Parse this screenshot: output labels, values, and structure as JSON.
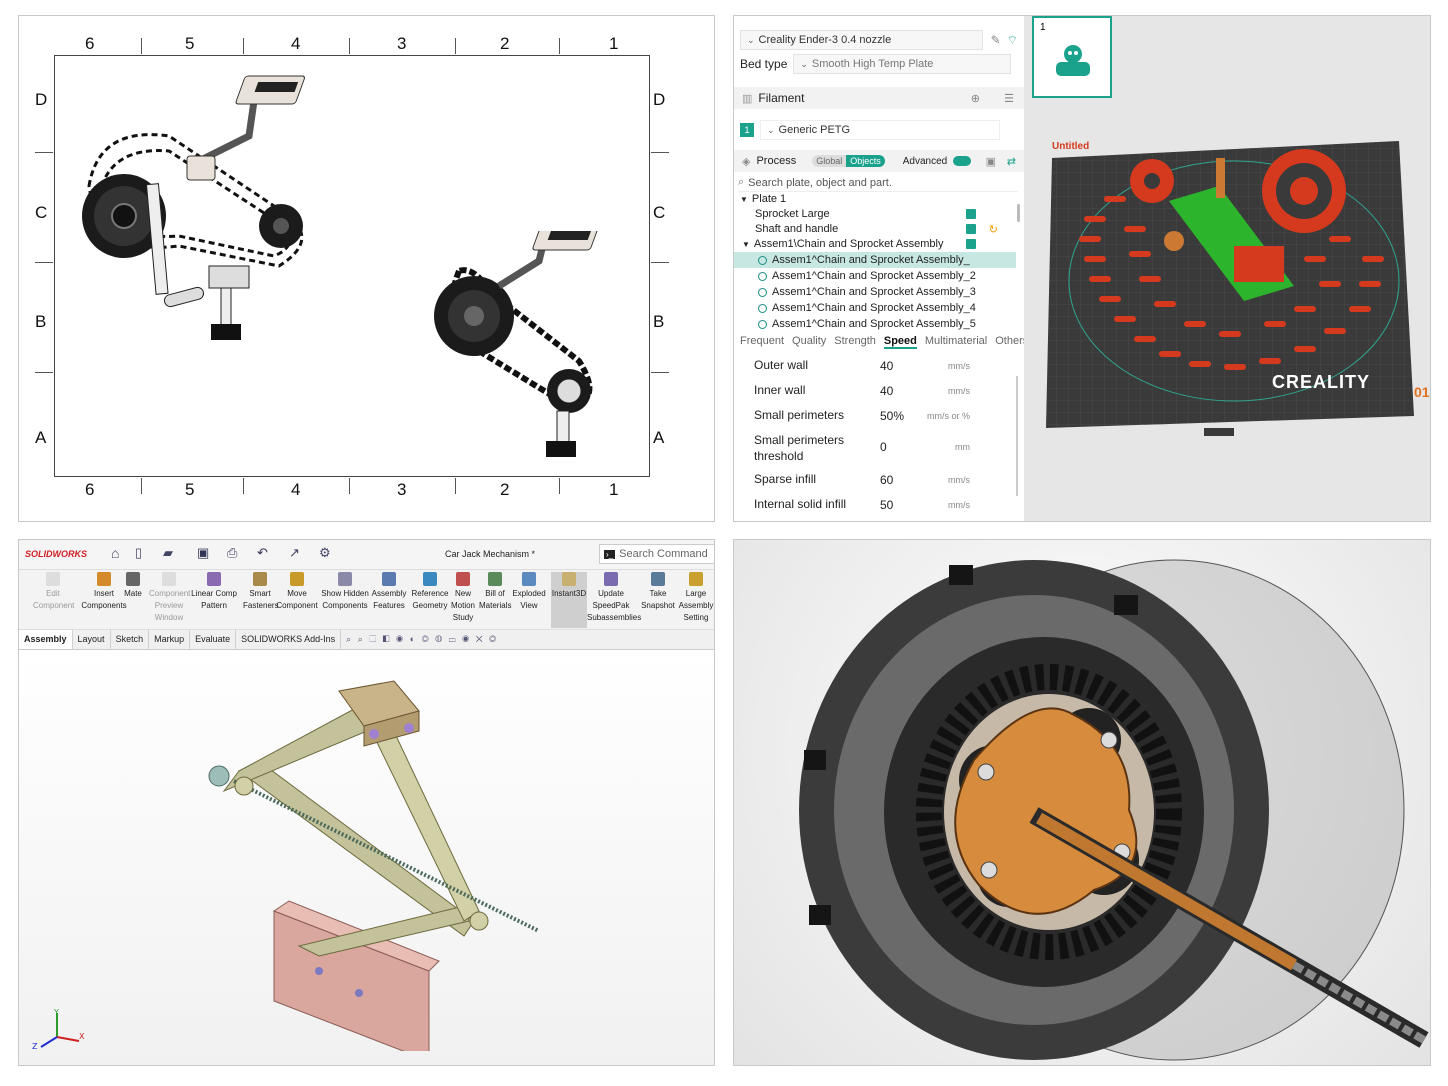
{
  "drawing": {
    "zones_top": [
      "6",
      "5",
      "4",
      "3",
      "2",
      "1"
    ],
    "zones_bottom": [
      "6",
      "5",
      "4",
      "3",
      "2",
      "1"
    ],
    "zones_left": [
      "D",
      "C",
      "B",
      "A"
    ],
    "zones_right": [
      "D",
      "C",
      "B",
      "A"
    ]
  },
  "slicer": {
    "printer": "Creality Ender-3 0.4 nozzle",
    "bed_type_label": "Bed type",
    "bed_type": "Smooth High Temp Plate",
    "filament_section": "Filament",
    "filament_index": "1",
    "filament": "Generic PETG",
    "process_section": "Process",
    "process_global": "Global",
    "process_objects": "Objects",
    "advanced_label": "Advanced",
    "search_placeholder": "Search plate, object and part.",
    "tree": {
      "plate": "Plate 1",
      "items": [
        "Sprocket Large",
        "Shaft and handle",
        "Assem1\\Chain and Sprocket Assembly"
      ],
      "subitems": [
        "Assem1^Chain and Sprocket Assembly_",
        "Assem1^Chain and Sprocket Assembly_2",
        "Assem1^Chain and Sprocket Assembly_3",
        "Assem1^Chain and Sprocket Assembly_4",
        "Assem1^Chain and Sprocket Assembly_5"
      ]
    },
    "tabs": [
      "Frequent",
      "Quality",
      "Strength",
      "Speed",
      "Multimaterial",
      "Others"
    ],
    "active_tab": "Speed",
    "params": [
      {
        "label": "Outer wall",
        "value": "40",
        "unit": "mm/s"
      },
      {
        "label": "Inner wall",
        "value": "40",
        "unit": "mm/s"
      },
      {
        "label": "Small perimeters",
        "value": "50%",
        "unit": "mm/s or %"
      },
      {
        "label": "Small perimeters threshold",
        "value": "0",
        "unit": "mm"
      },
      {
        "label": "Sparse infill",
        "value": "60",
        "unit": "mm/s"
      },
      {
        "label": "Internal solid infill",
        "value": "50",
        "unit": "mm/s"
      }
    ],
    "plate_thumb_number": "1",
    "plate_name": "Untitled",
    "brand": "CREALITY",
    "plate_index": "01",
    "colors": {
      "accent": "#1aa28d",
      "parts": "#d63a1e",
      "bed": "#3a3a3a"
    }
  },
  "solidworks": {
    "logo": "SOLIDWORKS",
    "title": "Car Jack Mechanism *",
    "search_placeholder": "Search Command",
    "commands": [
      {
        "label": "Edit Component",
        "disabled": true
      },
      {
        "label": "Insert Components",
        "disabled": false
      },
      {
        "label": "Mate",
        "disabled": false
      },
      {
        "label": "Component Preview Window",
        "disabled": true
      },
      {
        "label": "Linear Comp Pattern",
        "disabled": false
      },
      {
        "label": "Smart Fasteners",
        "disabled": false
      },
      {
        "label": "Move Component",
        "disabled": false
      },
      {
        "label": "Show Hidden Components",
        "disabled": false
      },
      {
        "label": "Assembly Features",
        "disabled": false
      },
      {
        "label": "Reference Geometry",
        "disabled": false
      },
      {
        "label": "New Motion Study",
        "disabled": false
      },
      {
        "label": "Bill of Materials",
        "disabled": false
      },
      {
        "label": "Exploded View",
        "disabled": false
      },
      {
        "label": "Instant3D",
        "disabled": false
      },
      {
        "label": "Update SpeedPak Subassemblies",
        "disabled": false
      },
      {
        "label": "Take Snapshot",
        "disabled": false
      },
      {
        "label": "Large Assembly Setting",
        "disabled": false
      }
    ],
    "tabs": [
      "Assembly",
      "Layout",
      "Sketch",
      "Markup",
      "Evaluate",
      "SOLIDWORKS Add-Ins"
    ],
    "active_tab": "Assembly",
    "triad": {
      "x": "X",
      "y": "Y",
      "z": "Z"
    }
  }
}
